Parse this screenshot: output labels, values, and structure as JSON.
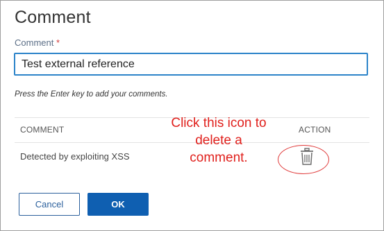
{
  "dialog": {
    "title": "Comment",
    "field_label": "Comment",
    "required_marker": "*",
    "input_value": "Test external reference",
    "hint": "Press the Enter key to add your comments."
  },
  "table": {
    "headers": {
      "comment": "COMMENT",
      "action": "ACTION"
    },
    "rows": [
      {
        "comment": "Detected by exploiting XSS",
        "action_icon": "trash-icon"
      }
    ]
  },
  "annotation": {
    "text_line1": "Click this icon to",
    "text_line2": "delete a",
    "text_line3": "comment.",
    "color": "#e0201c"
  },
  "buttons": {
    "cancel": "Cancel",
    "ok": "OK"
  },
  "colors": {
    "accent": "#2b83c9",
    "primary_button": "#0f5fb1",
    "required": "#d23a3a"
  }
}
